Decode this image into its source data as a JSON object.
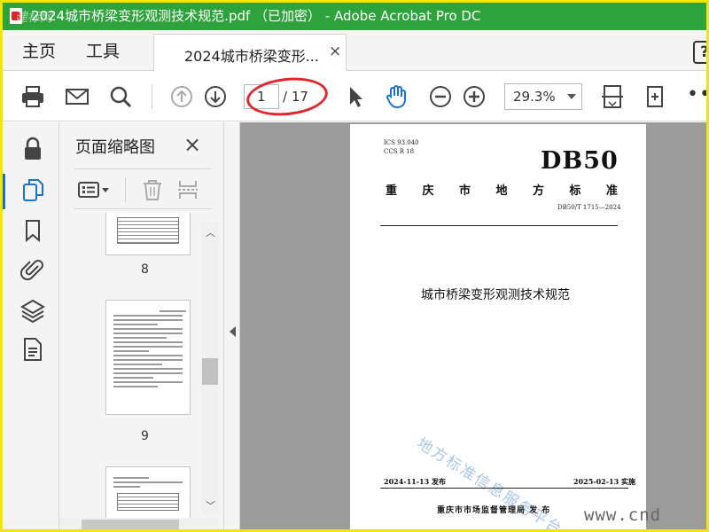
{
  "window": {
    "title": "2024城市桥梁变形观测技术规范.pdf （已加密） - Adobe Acrobat Pro DC",
    "watermark": "建标网"
  },
  "menu": {
    "home": "主页",
    "tools": "工具",
    "doc_tab": "2024城市桥梁变形...",
    "close_symbol": "×",
    "help_symbol": "?"
  },
  "toolbar": {
    "current_page": "1",
    "total_pages": "/ 17",
    "zoom": "29.3%",
    "more": "•••"
  },
  "thumbnail_panel": {
    "title": "页面缩略图",
    "close_symbol": "×",
    "pages": [
      "8",
      "9"
    ]
  },
  "document": {
    "ics": "ICS 93.040",
    "ccs": "CCS R 18",
    "standard_code": "DB50",
    "issuer_region": [
      "重",
      "庆",
      "市",
      "地",
      "方",
      "标",
      "准"
    ],
    "standard_number": "DB50/T 1715—2024",
    "doc_title": "城市桥梁变形观测技术规范",
    "watermark": "地方标准信息服务平台",
    "publish_date": "2024-11-13 发布",
    "implement_date": "2025-02-13 实施",
    "issuer": "重庆市市场监督管理局  发 布"
  },
  "site_watermark": "www.cnd",
  "colors": {
    "titlebar": "#2ea33c",
    "frame_border": "#f3e600",
    "annotation": "#e0262c",
    "active_accent": "#1a73c9"
  },
  "icons": {
    "toolbar": [
      "print-icon",
      "email-icon",
      "search-icon",
      "page-up-icon",
      "page-down-icon",
      "select-cursor-icon",
      "hand-tool-icon",
      "zoom-out-icon",
      "zoom-in-icon",
      "fit-page-icon",
      "rotate-fit-icon"
    ],
    "rail": [
      "lock-icon",
      "pages-icon",
      "bookmark-icon",
      "attachment-icon",
      "layers-icon",
      "document-props-icon"
    ]
  }
}
